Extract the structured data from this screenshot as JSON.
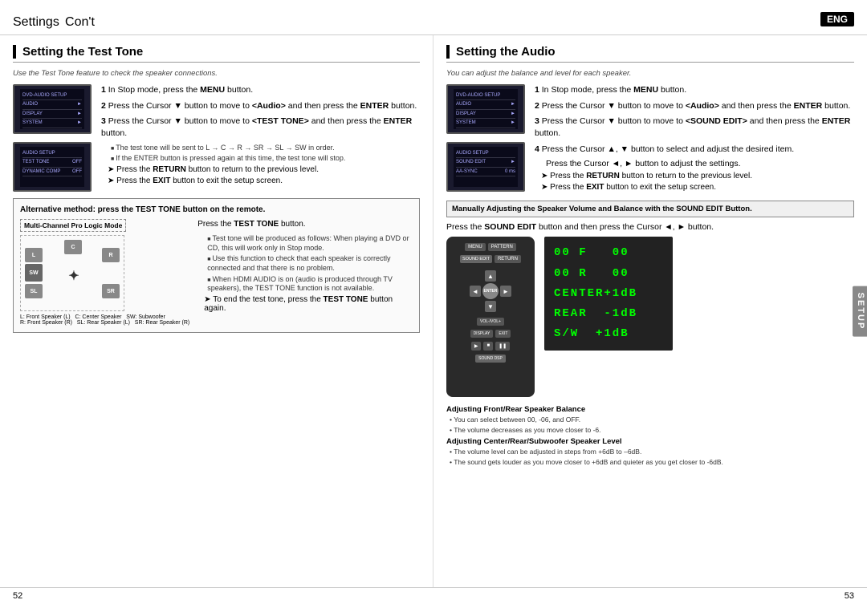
{
  "header": {
    "title": "Settings",
    "subtitle": "Con't",
    "eng_label": "ENG"
  },
  "left": {
    "section_title": "Setting the Test Tone",
    "section_subtitle": "Use the Test Tone feature to check the speaker connections.",
    "steps": [
      {
        "num": "1",
        "text": "In Stop mode, press the ",
        "bold": "MENU",
        "text2": " button."
      },
      {
        "num": "2",
        "text": "Press the Cursor ▼ button to move to ",
        "angle": "<Audio>",
        "text2": " and then press the ",
        "bold": "ENTER",
        "text3": " button."
      },
      {
        "num": "3",
        "text": "Press the Cursor ▼ button to move to ",
        "angle": "<TEST TONE>",
        "text2": " and then press the ",
        "bold": "ENTER",
        "text3": " button."
      }
    ],
    "bullet_notes": [
      "The test tone will be sent to L → C → R → SR → SL → SW in order.",
      "If the ENTER button is pressed again at this time, the test tone will stop."
    ],
    "arrow_notes": [
      "Press the RETURN button to return to the previous level.",
      "Press the EXIT button to exit the setup screen."
    ],
    "alt_method": {
      "title": "Alternative method: press the TEST TONE button on the remote.",
      "diagram_label": "Multi-Channel Pro Logic Mode",
      "speakers": [
        "L",
        "C",
        "R",
        "SW",
        "SL",
        "SR"
      ],
      "speaker_labels_text": "L: Front Speaker (L)   C: Center Speaker   SW: Subwoofer\nR: Front Speaker (R)   SL: Rear Speaker (L)   SR: Rear Speaker (R)",
      "press_text": "Press the ",
      "press_bold": "TEST TONE",
      "press_text2": " button.",
      "bullet_notes": [
        "Test tone will be produced as follows: When playing a DVD or CD, this will work only in Stop mode.",
        "Use this function to check that each speaker is correctly connected and that there is no problem.",
        "When HDMI AUDIO is on (audio is produced through TV speakers), the TEST TONE function is not available."
      ],
      "arrow_note": "To end the test tone, press the ",
      "arrow_bold": "TEST TONE",
      "arrow_text2": " button again."
    }
  },
  "right": {
    "section_title": "Setting the Audio",
    "section_subtitle": "You can adjust the balance and level for each speaker.",
    "steps": [
      {
        "num": "1",
        "text": "In Stop mode, press the ",
        "bold": "MENU",
        "text2": " button."
      },
      {
        "num": "2",
        "text": "Press the Cursor ▼ button to move to ",
        "angle": "<Audio>",
        "text2": " and then press the ",
        "bold": "ENTER",
        "text3": " button."
      },
      {
        "num": "3",
        "text": "Press the Cursor ▼ button to move to ",
        "angle": "<SOUND EDIT>",
        "text2": " and then press the ",
        "bold": "ENTER",
        "text3": " button."
      },
      {
        "num": "4",
        "text": "Press the Cursor ▲, ▼ button to select and adjust the desired item."
      }
    ],
    "step4_sub": "Press the Cursor ◄, ► button to adjust the settings.",
    "arrow_notes": [
      "Press the RETURN button to return to the previous level.",
      "Press the EXIT button to exit the setup screen."
    ],
    "manually_title": "Manually Adjusting the Speaker Volume and Balance with the SOUND EDIT Button.",
    "manually_desc": "Press the SOUND EDIT button and then press the Cursor ◄, ► button.",
    "sound_edit_display": [
      "00 F  00",
      "00 R  00",
      "CENTER+1dB",
      "REAR  -1dB",
      "S/W  +1dB"
    ],
    "adjusting": [
      {
        "title": "Adjusting Front/Rear Speaker Balance",
        "notes": [
          "You can select between 00, -06, and OFF.",
          "The volume decreases as you move closer to -6."
        ]
      },
      {
        "title": "Adjusting Center/Rear/Subwoofer Speaker Level",
        "notes": [
          "The volume level can be adjusted in steps from +6dB to –6dB.",
          "The sound gets louder as you move closer to +6dB and quieter as you get closer to -6dB."
        ]
      }
    ]
  },
  "footer": {
    "left_page": "52",
    "right_page": "53"
  }
}
